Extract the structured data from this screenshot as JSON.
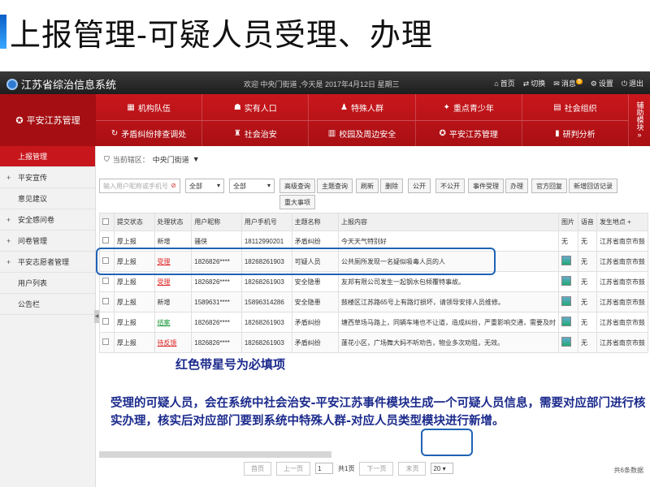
{
  "slide": {
    "title": "上报管理-可疑人员受理、办理",
    "note1": "红色带星号为必填项",
    "note2": "受理的可疑人员，会在系统中社会治安-平安江苏事件模块生成一个可疑人员信息，需要对应部门进行核实办理，核实后对应部门要到系统中特殊人群-对应人员类型模块进行新增。"
  },
  "app": {
    "name": "江苏省综治信息系统",
    "welcome": "欢迎 中央门街道 ,今天是 2017年4月12日 星期三",
    "actions": [
      "首页",
      "切换",
      "消息",
      "设置",
      "退出"
    ],
    "msg_count": "9"
  },
  "nav": {
    "brand": "平安江苏管理",
    "row1": [
      "机构队伍",
      "实有人口",
      "特殊人群",
      "重点青少年",
      "社会组织"
    ],
    "row2": [
      "矛盾纠纷排查调处",
      "社会治安",
      "校园及周边安全",
      "平安江苏管理",
      "研判分析"
    ],
    "side": "辅助模块"
  },
  "sidemenu": [
    {
      "label": "上报管理",
      "active": true,
      "expand": false
    },
    {
      "label": "平安宣传",
      "active": false,
      "expand": true
    },
    {
      "label": "意见建议",
      "active": false,
      "expand": false
    },
    {
      "label": "安全感问卷",
      "active": false,
      "expand": true
    },
    {
      "label": "问卷管理",
      "active": false,
      "expand": true
    },
    {
      "label": "平安志愿者管理",
      "active": false,
      "expand": true
    },
    {
      "label": "用户列表",
      "active": false,
      "expand": false
    },
    {
      "label": "公告栏",
      "active": false,
      "expand": false
    }
  ],
  "content": {
    "location_label": "当前辖区：",
    "location_value": "中央门街道",
    "search_placeholder": "输入用户昵称或手机号",
    "select1": "全部",
    "select2": "全部",
    "buttons": [
      "高级查询",
      "主题查询",
      "刷新",
      "删除",
      "公开",
      "不公开",
      "事件受理",
      "办理",
      "官方回复",
      "新增回访记录"
    ],
    "button_extra": "重大事项",
    "columns": [
      "提交状态",
      "处理状态",
      "用户昵称",
      "用户手机号",
      "主题名称",
      "上报内容",
      "图片",
      "语音",
      "发生地点"
    ],
    "rows": [
      {
        "submit": "厚上报",
        "status": "新增",
        "status_style": "plain",
        "nick": "骚侠",
        "phone": "18112990201",
        "topic": "矛盾纠纷",
        "content": "今天天气特别好",
        "img": "无",
        "voice": "无",
        "place": "江苏省南京市鼓"
      },
      {
        "submit": "厚上报",
        "status": "受理",
        "status_style": "red",
        "nick": "1826826****",
        "phone": "18268261903",
        "topic": "可疑人员",
        "content": "公共厕所发现一名疑似吸毒人员的人",
        "img": "thumb",
        "voice": "无",
        "place": "江苏省南京市鼓"
      },
      {
        "submit": "厚上报",
        "status": "受理",
        "status_style": "red",
        "nick": "1826826****",
        "phone": "18268261903",
        "topic": "安全隐患",
        "content": "友邦有限公司发生一起钢水包倾覆特事故。",
        "img": "thumb",
        "voice": "无",
        "place": "江苏省南京市鼓"
      },
      {
        "submit": "厚上报",
        "status": "新增",
        "status_style": "plain",
        "nick": "1589631****",
        "phone": "15896314286",
        "topic": "安全隐患",
        "content": "鼓楼区江苏路65号上有路灯损坏，请领导安排人员维修。",
        "img": "thumb",
        "voice": "无",
        "place": "江苏省南京市鼓"
      },
      {
        "submit": "厚上报",
        "status": "结案",
        "status_style": "green",
        "nick": "1826826****",
        "phone": "18268261903",
        "topic": "矛盾纠纷",
        "content": "塘西草场马路上，同辆车堵也不让道，造成纠纷，严重影响交通，需要及时",
        "img": "thumb",
        "voice": "无",
        "place": "江苏省南京市鼓"
      },
      {
        "submit": "厚上报",
        "status": "待反馈",
        "status_style": "red",
        "nick": "1826826****",
        "phone": "18268261903",
        "topic": "矛盾纠纷",
        "content": "蓬花小区，广场舞大妈不听劝告，物业多次劝阻，无效。",
        "img": "thumb",
        "voice": "无",
        "place": "江苏省南京市鼓"
      }
    ]
  },
  "pager": {
    "first": "首页",
    "prev": "上一页",
    "page": "1",
    "total_pages": "共1页",
    "next": "下一页",
    "last": "末页",
    "page_size": "20",
    "total": "共6条数据"
  },
  "colors": {
    "accent_red": "#c8161d",
    "note_blue": "#1b2a8c",
    "highlight_blue": "#1f63b5"
  }
}
